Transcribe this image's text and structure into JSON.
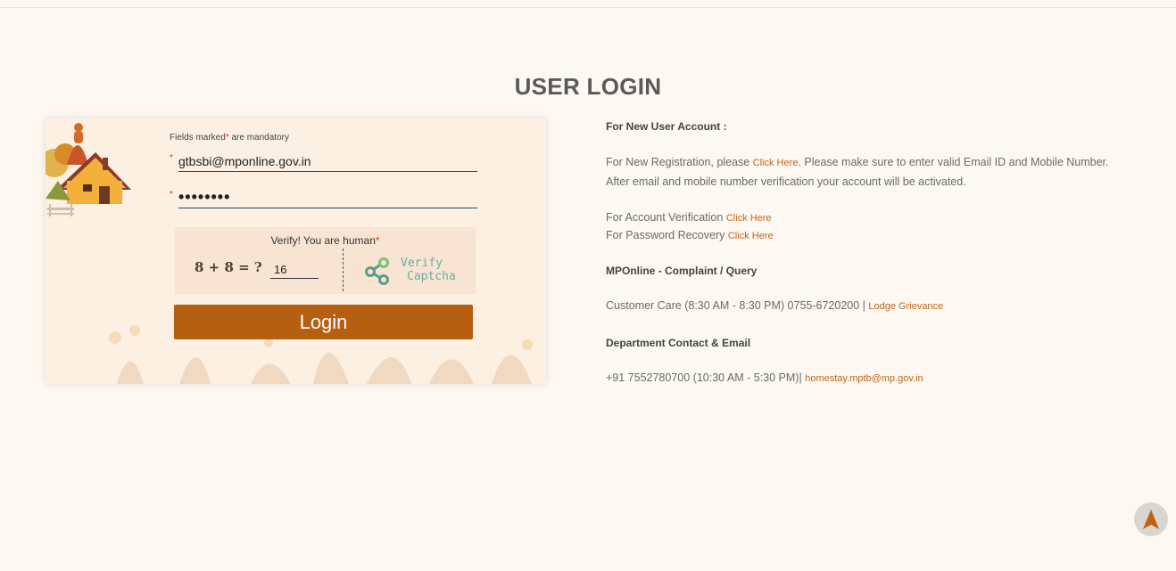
{
  "page": {
    "title": "USER LOGIN"
  },
  "login_form": {
    "mandatory_note_prefix": "Fields marked",
    "mandatory_star": "*",
    "mandatory_note_suffix": "are mandatory",
    "required_marker": "*",
    "email_value": "gtbsbi@mponline.gov.in",
    "password_value": "password",
    "captcha_title": "Verify! You are human",
    "captcha_question": "8 + 8 = ?",
    "captcha_answer": "16",
    "verify_captcha_line1": "Verify",
    "verify_captcha_line2": "Captcha",
    "login_label": "Login"
  },
  "info": {
    "new_user_heading": "For New User Account :",
    "registration_prefix": "For New Registration, please",
    "registration_link": "Click Here",
    "registration_suffix": ". Please make sure to enter valid Email ID and Mobile Number. After email and mobile number verification your account will be activated.",
    "account_verification_label": "For Account Verification",
    "account_verification_link": "Click Here",
    "password_recovery_label": "For Password Recovery",
    "password_recovery_link": "Click Here",
    "complaint_heading": "MPOnline - Complaint / Query",
    "customer_care_text": "Customer Care (8:30 AM - 8:30 PM) 0755-6720200 |",
    "lodge_grievance_link": "Lodge Grievance",
    "department_heading": "Department Contact & Email",
    "department_phone_text": "+91 7552780700 (10:30 AM - 5:30 PM)|",
    "department_email_link": "homestay.mptb@mp.gov.in"
  },
  "icons": {
    "scroll_top": "navigation-arrow-icon",
    "verify_captcha": "share-nodes-icon",
    "house": "house-illustration"
  },
  "colors": {
    "background": "#fdf8f1",
    "login_button": "#b65f10",
    "link": "#c0661b",
    "required_star": "#d9302f",
    "verify_text": "#6cae9f"
  }
}
